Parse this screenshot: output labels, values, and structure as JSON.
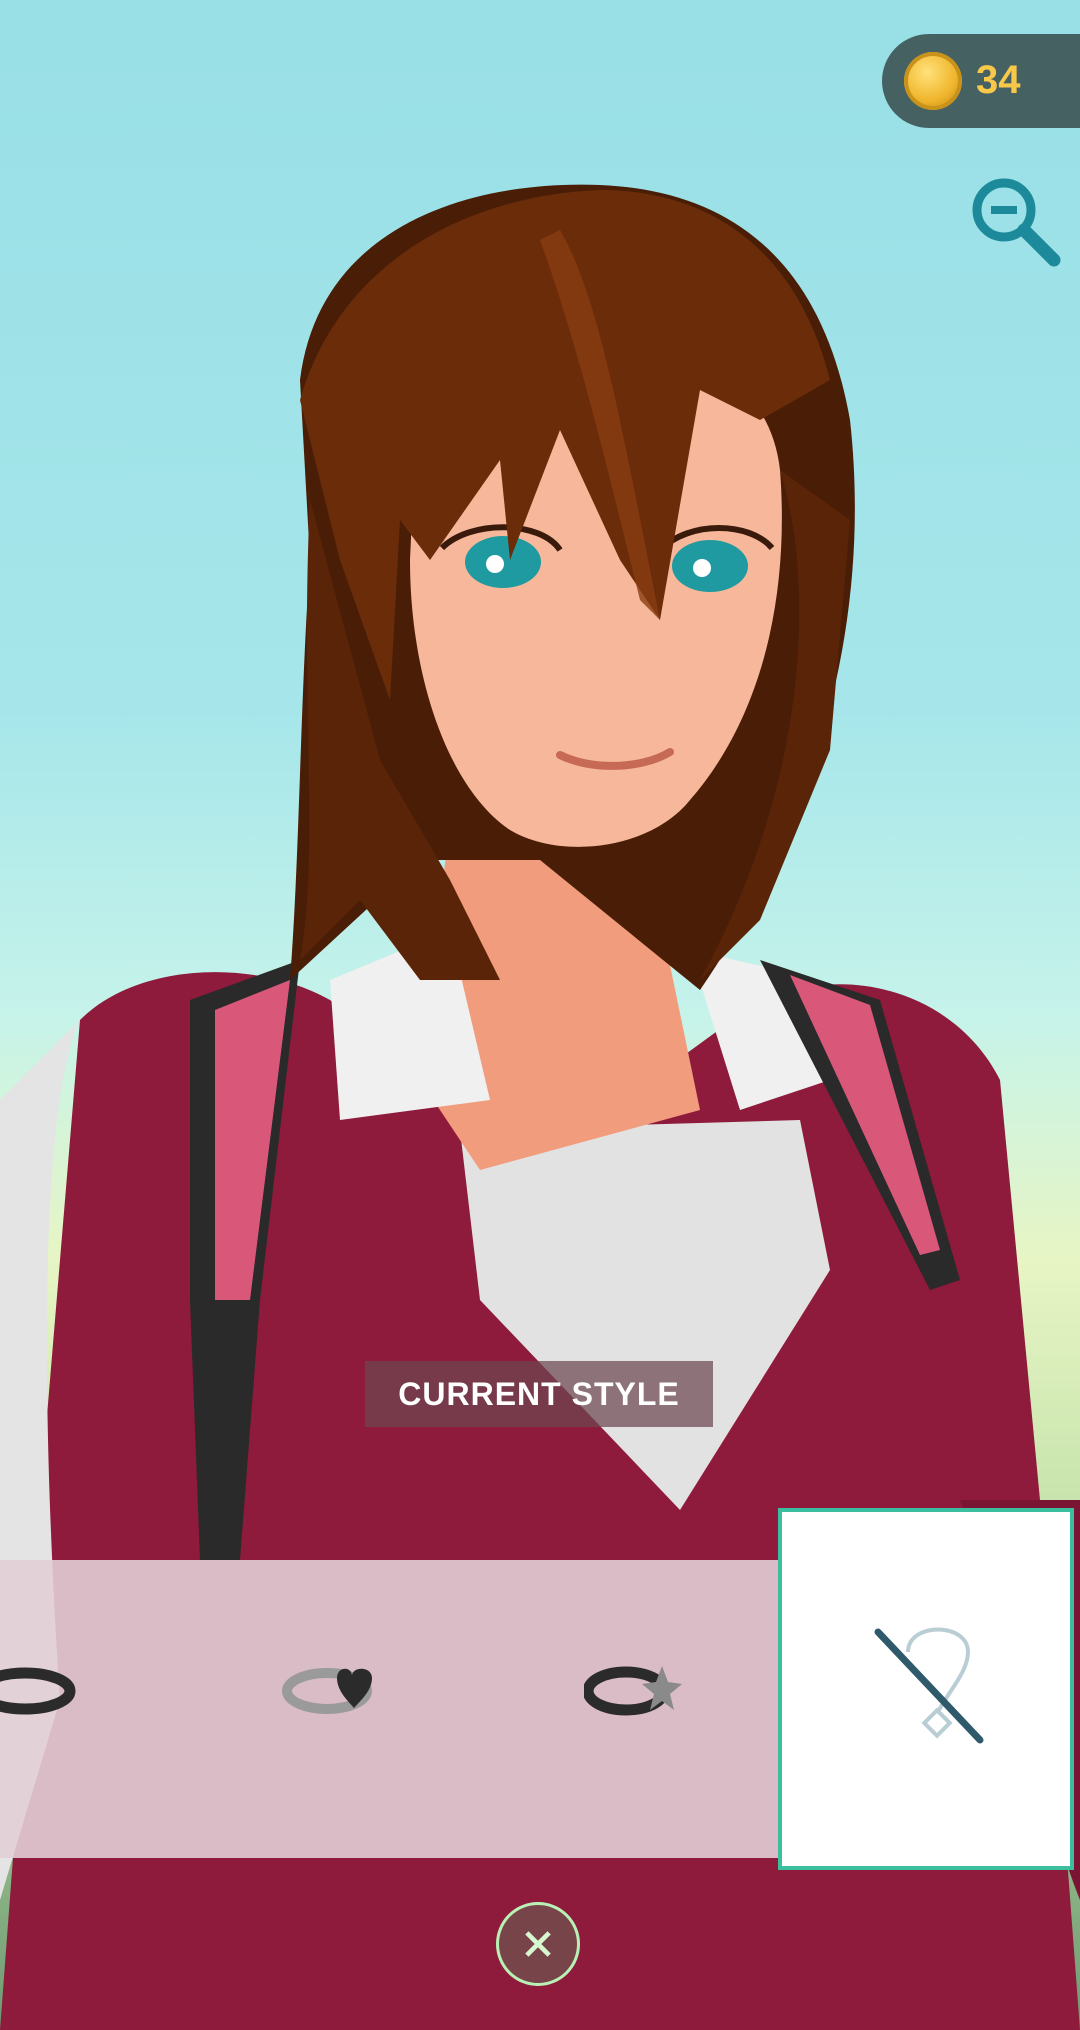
{
  "header": {
    "coins": "34",
    "coin_icon": "pokecoin-icon",
    "zoom_icon": "zoom-out-icon"
  },
  "style_label": "CURRENT STYLE",
  "items": [
    {
      "name": "ring-plain",
      "icon": "ring-icon"
    },
    {
      "name": "ring-heart",
      "icon": "ring-heart-icon"
    },
    {
      "name": "ring-star",
      "icon": "ring-star-icon"
    }
  ],
  "selected_item": {
    "icon": "no-necklace-icon"
  },
  "close_icon": "close-icon",
  "colors": {
    "accent": "#3cbf9f",
    "coin_text": "#f7c84a",
    "jacket": "#8e1a3c"
  }
}
